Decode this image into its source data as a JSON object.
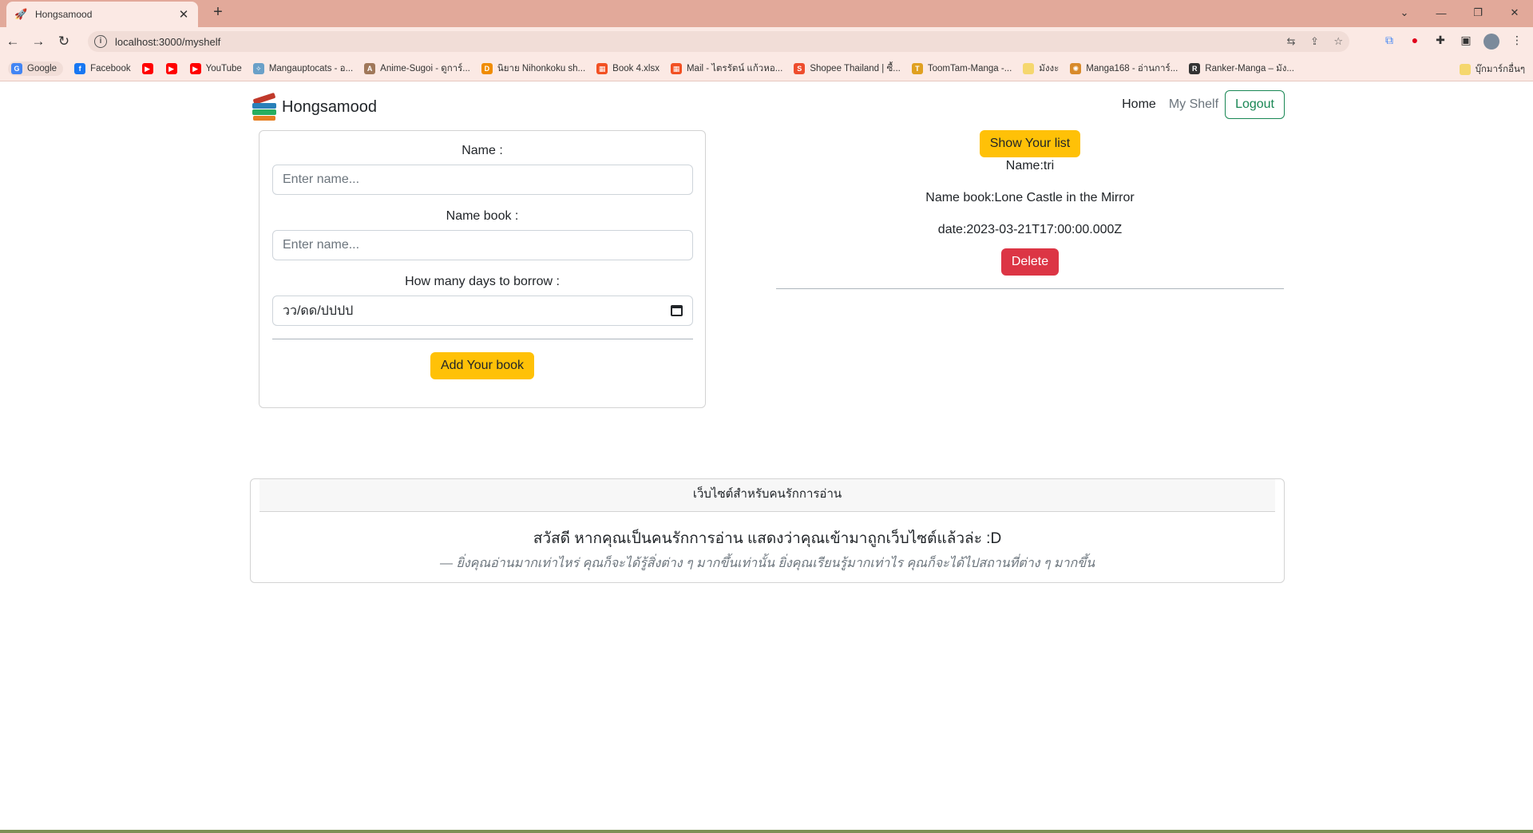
{
  "browser": {
    "tab_title": "Hongsamood",
    "tab_icon": "rocket-icon",
    "url": "localhost:3000/myshelf",
    "bookmarks": [
      {
        "label": "Google",
        "color": "#4285f4",
        "glyph": "G"
      },
      {
        "label": "Facebook",
        "color": "#1877f2",
        "glyph": "f"
      },
      {
        "label": "",
        "color": "#ff0000",
        "glyph": "▶"
      },
      {
        "label": "",
        "color": "#ff0000",
        "glyph": "▶"
      },
      {
        "label": "YouTube",
        "color": "#ff0000",
        "glyph": "▶"
      },
      {
        "label": "Mangauptocats - อ...",
        "color": "#6aa0c8",
        "glyph": "✧"
      },
      {
        "label": "Anime-Sugoi - ดูการ์...",
        "color": "#a0785a",
        "glyph": "A"
      },
      {
        "label": "นิยาย Nihonkoku sh...",
        "color": "#f08c00",
        "glyph": "D"
      },
      {
        "label": "Book 4.xlsx",
        "color": "#f25022",
        "glyph": "▦"
      },
      {
        "label": "Mail - ไตรรัตน์ แก้วหอ...",
        "color": "#f25022",
        "glyph": "▦"
      },
      {
        "label": "Shopee Thailand | ซื้...",
        "color": "#ee4d2d",
        "glyph": "S"
      },
      {
        "label": "ToomTam-Manga -...",
        "color": "#e0a020",
        "glyph": "T"
      },
      {
        "label": "มังงะ",
        "color": "#f5d76e",
        "glyph": ""
      },
      {
        "label": "Manga168 - อ่านการ์...",
        "color": "#d88a2a",
        "glyph": "✺"
      },
      {
        "label": "Ranker-Manga – มัง...",
        "color": "#333333",
        "glyph": "R"
      }
    ],
    "bookmarks_right": "บุ๊กมาร์กอื่นๆ"
  },
  "navbar": {
    "brand": "Hongsamood",
    "links": {
      "home": "Home",
      "shelf": "My Shelf"
    },
    "logout": "Logout"
  },
  "form": {
    "name_label": "Name :",
    "name_placeholder": "Enter name...",
    "book_label": "Name book :",
    "book_placeholder": "Enter name...",
    "days_label": "How many days to borrow :",
    "date_placeholder": "วว/ดด/ปปปป",
    "submit": "Add Your book"
  },
  "list": {
    "show_button": "Show Your list",
    "items": [
      {
        "name": "Name:tri",
        "book": "Name book:Lone Castle in the Mirror",
        "date": "date:2023-03-21T17:00:00.000Z",
        "delete": "Delete"
      }
    ]
  },
  "footer": {
    "header": "เว็บไซต์สำหรับคนรักการอ่าน",
    "title": "สวัสดี หากคุณเป็นคนรักการอ่าน แสดงว่าคุณเข้ามาถูกเว็บไซต์แล้วล่ะ :D",
    "quote": "— ยิ่งคุณอ่านมากเท่าไหร่ คุณก็จะได้รู้สิ่งต่าง ๆ มากขึ้นเท่านั้น ยิ่งคุณเรียนรู้มากเท่าไร คุณก็จะได้ไปสถานที่ต่าง ๆ มากขึ้น"
  },
  "colors": {
    "accent_yellow": "#ffc107",
    "danger_red": "#dc3545",
    "success_green": "#198754",
    "browser_frame": "#e2a99a"
  }
}
